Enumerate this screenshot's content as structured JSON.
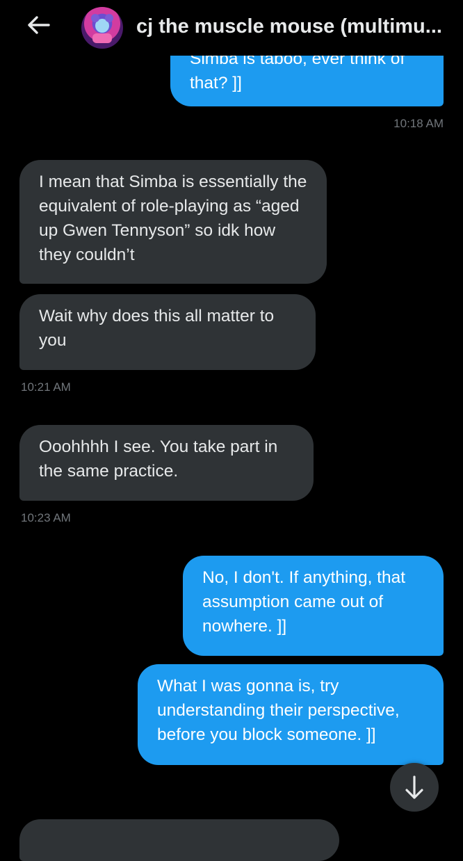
{
  "header": {
    "title": "cj the muscle mouse (multimu...",
    "back_icon": "back-arrow-icon",
    "avatar": "avatar"
  },
  "messages": [
    {
      "type": "sent",
      "text": "Simba is taboo, ever think of that? ]]"
    },
    {
      "type": "timestamp",
      "text": "10:18 AM"
    },
    {
      "type": "received",
      "text": "I mean that Simba is essentially the equivalent of role-playing as “aged up Gwen Tennyson” so idk how they couldn’t"
    },
    {
      "type": "received",
      "text": "Wait why does this all matter to you"
    },
    {
      "type": "timestamp",
      "text": "10:21 AM"
    },
    {
      "type": "received",
      "text": "Ooohhhh I see. You take part in the same practice."
    },
    {
      "type": "timestamp",
      "text": "10:23 AM"
    },
    {
      "type": "sent",
      "text": "No, I don't. If anything, that assumption came out of nowhere. ]]"
    },
    {
      "type": "sent",
      "text": "What I was gonna is, try understanding their perspective, before you block someone. ]]"
    }
  ],
  "scroll_button": {
    "icon": "arrow-down-icon"
  },
  "colors": {
    "background": "#000000",
    "sent_bubble": "#1d9bf0",
    "received_bubble": "#2f3336",
    "timestamp": "#71767b"
  }
}
